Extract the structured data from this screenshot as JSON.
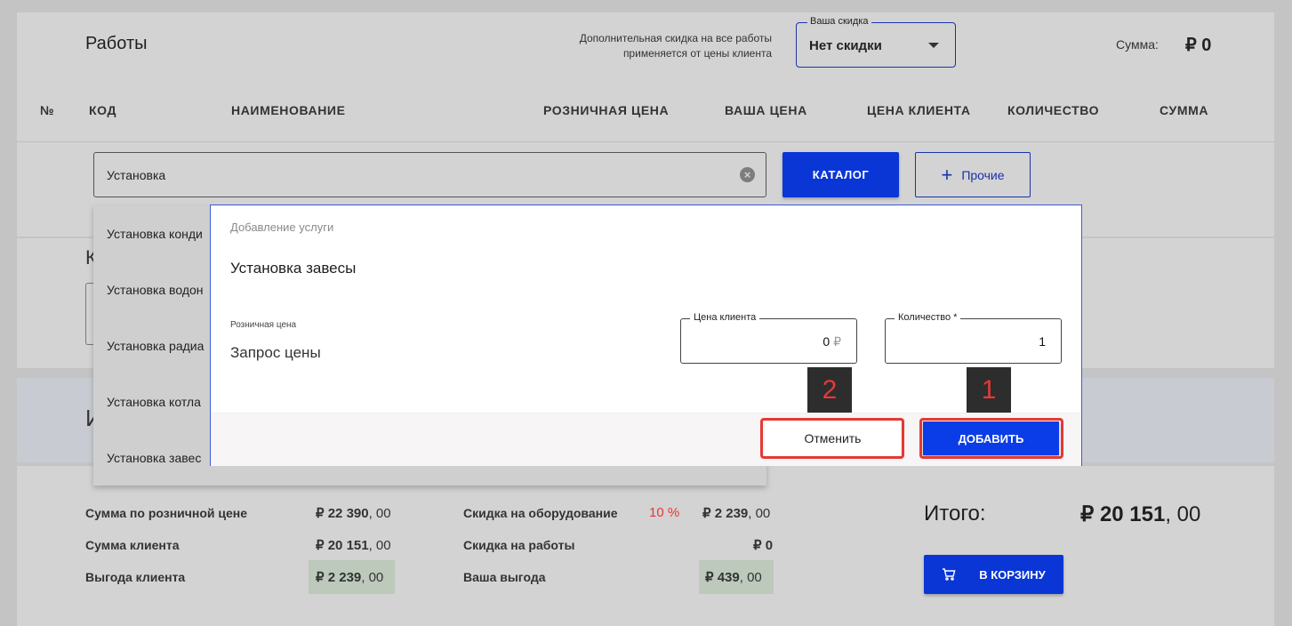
{
  "works": {
    "title": "Работы",
    "discount_note_line1": "Дополнительная скидка на все работы",
    "discount_note_line2": "применяется от цены клиента",
    "discount_select": {
      "legend": "Ваша скидка",
      "value": "Нет скидки"
    },
    "sum_label": "Сумма:",
    "sum_value": "₽ 0"
  },
  "table_headers": [
    "№",
    "КОД",
    "НАИМЕНОВАНИЕ",
    "РОЗНИЧНАЯ ЦЕНА",
    "ВАША ЦЕНА",
    "ЦЕНА КЛИЕНТА",
    "КОЛИЧЕСТВО",
    "СУММА"
  ],
  "search": {
    "value": "Установка"
  },
  "buttons": {
    "catalog": "КАТАЛОГ",
    "other": "Прочие",
    "cart": "В КОРЗИНУ"
  },
  "dropdown_items": [
    "Установка конди",
    "Установка водон",
    "Установка радиа",
    "Установка котла",
    "Установка завес"
  ],
  "background_fragments": {
    "section_letter_1": "К",
    "section_letter_2": "И"
  },
  "modal": {
    "header": "Добавление услуги",
    "service_name": "Установка завесы",
    "retail_label": "Розничная цена",
    "retail_value": "Запрос цены",
    "client_price": {
      "legend": "Цена клиента",
      "value": "0",
      "currency": "₽"
    },
    "quantity": {
      "legend": "Количество *",
      "value": "1"
    },
    "cancel": "Отменить",
    "add": "ДОБАВИТЬ"
  },
  "callouts": {
    "first": "1",
    "second": "2"
  },
  "totals": {
    "retail_sum_label": "Сумма по розничной цене",
    "retail_sum_int": "₽ 22 390",
    "retail_sum_dec": ", 00",
    "client_sum_label": "Сумма клиента",
    "client_sum_int": "₽ 20 151",
    "client_sum_dec": ", 00",
    "client_benefit_label": "Выгода клиента",
    "client_benefit_int": "₽ 2 239",
    "client_benefit_dec": ", 00",
    "equip_discount_label": "Скидка на оборудование",
    "equip_discount_pct": "10 %",
    "equip_discount_int": "₽ 2 239",
    "equip_discount_dec": ", 00",
    "works_discount_label": "Скидка на работы",
    "works_discount_value": "₽ 0",
    "your_benefit_label": "Ваша выгода",
    "your_benefit_int": "₽ 439",
    "your_benefit_dec": ", 00",
    "total_label": "Итого:",
    "total_int": "₽ 20 151",
    "total_dec": ", 00"
  },
  "colors": {
    "primary": "#0a36d6",
    "highlight": "#e53935",
    "benefit_chip": "#bcc9bb"
  }
}
